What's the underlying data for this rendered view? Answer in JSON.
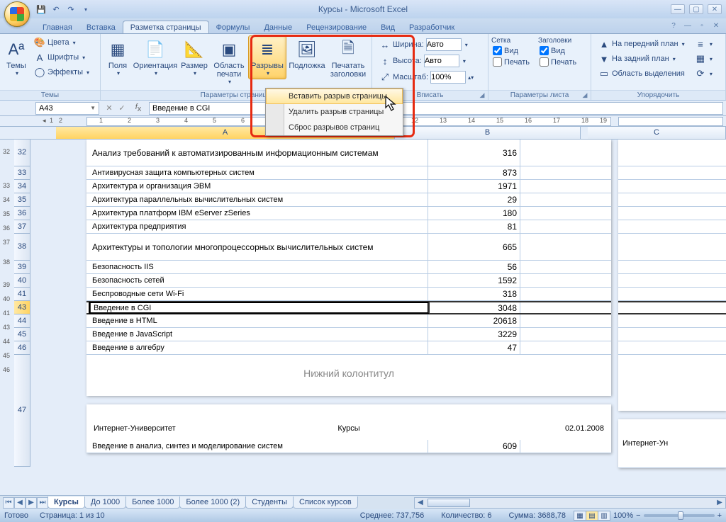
{
  "app": {
    "title": "Курсы - Microsoft Excel"
  },
  "tabs": {
    "home": "Главная",
    "insert": "Вставка",
    "page_layout": "Разметка страницы",
    "formulas": "Формулы",
    "data": "Данные",
    "review": "Рецензирование",
    "view": "Вид",
    "developer": "Разработчик"
  },
  "ribbon": {
    "themes_group": "Темы",
    "themes_btn": "Темы",
    "colors": "Цвета",
    "fonts": "Шрифты",
    "effects": "Эффекты",
    "page_setup_group": "Параметры страницы",
    "margins": "Поля",
    "orientation": "Ориентация",
    "size": "Размер",
    "print_area": "Область печати",
    "breaks": "Разрывы",
    "background": "Подложка",
    "print_titles": "Печатать заголовки",
    "scale_group": "Вписать",
    "width": "Ширина:",
    "height": "Высота:",
    "scale": "Масштаб:",
    "auto": "Авто",
    "scale_val": "100%",
    "sheet_opts_group": "Параметры листа",
    "gridlines": "Сетка",
    "headings": "Заголовки",
    "view_cb": "Вид",
    "print_cb": "Печать",
    "arrange_group": "Упорядочить",
    "bring_front": "На передний план",
    "send_back": "На задний план",
    "selection_pane": "Область выделения"
  },
  "dropdown": {
    "insert_break": "Вставить разрыв страницы",
    "remove_break": "Удалить разрыв страницы",
    "reset_breaks": "Сброс разрывов страниц"
  },
  "namebox": "A43",
  "formula": "Введение в CGI",
  "columns": {
    "a": "A",
    "b": "B",
    "c": "C"
  },
  "rows": {
    "r32": {
      "text": "Анализ требований к автоматизированным информационным системам",
      "val": "316"
    },
    "r33": {
      "text": "Антивирусная защита компьютерных систем",
      "val": "873"
    },
    "r34": {
      "text": "Архитектура и организация ЭВМ",
      "val": "1971"
    },
    "r35": {
      "text": "Архитектура параллельных вычислительных систем",
      "val": "29"
    },
    "r36": {
      "text": "Архитектура платформ IBM eServer zSeries",
      "val": "180"
    },
    "r37": {
      "text": "Архитектура предприятия",
      "val": "81"
    },
    "r38": {
      "text": "Архитектуры и топологии многопроцессорных вычислительных систем",
      "val": "665"
    },
    "r39": {
      "text": "Безопасность IIS",
      "val": "56"
    },
    "r40": {
      "text": "Безопасность сетей",
      "val": "1592"
    },
    "r41": {
      "text": "Беспроводные сети Wi-Fi",
      "val": "318"
    },
    "r43": {
      "text": "Введение в CGI",
      "val": "3048"
    },
    "r44": {
      "text": "Введение в HTML",
      "val": "20618"
    },
    "r45": {
      "text": "Введение в JavaScript",
      "val": "3229"
    },
    "r46": {
      "text": "Введение в алгебру",
      "val": "47"
    },
    "r47": {
      "text": "Введение в анализ, синтез и моделирование систем",
      "val": "609"
    }
  },
  "footer_text": "Нижний колонтитул",
  "header": {
    "left": "Интернет-Университет",
    "center": "Курсы",
    "right": "02.01.2008",
    "right_page2": "Интернет-Ун"
  },
  "sheets": {
    "s1": "Курсы",
    "s2": "До 1000",
    "s3": "Более 1000",
    "s4": "Более 1000 (2)",
    "s5": "Студенты",
    "s6": "Список курсов"
  },
  "status": {
    "ready": "Готово",
    "page": "Страница: 1 из 10",
    "avg": "Среднее: 737,756",
    "count": "Количество: 6",
    "sum": "Сумма: 3688,78",
    "zoom": "100%"
  }
}
